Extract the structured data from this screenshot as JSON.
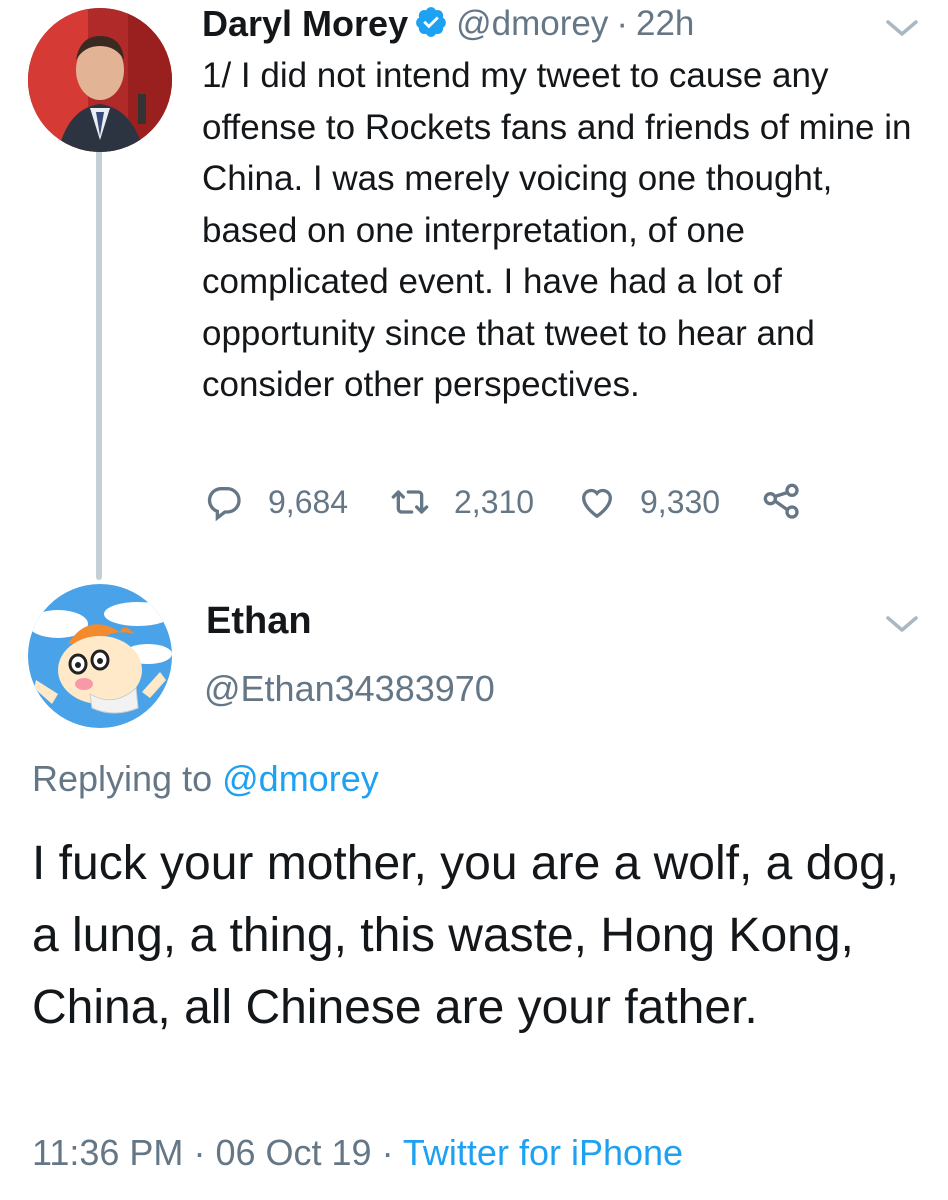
{
  "original_tweet": {
    "author_name": "Daryl Morey",
    "handle": "@dmorey",
    "time_sep": "·",
    "time": "22h",
    "verified": true,
    "text": "1/ I did not intend my tweet to cause any offense to Rockets fans and friends of mine in China. I was merely voicing one thought, based on one interpretation, of one complicated event. I have had a lot of opportunity since that tweet to hear and consider other perspectives.",
    "actions": {
      "replies": "9,684",
      "retweets": "2,310",
      "likes": "9,330"
    },
    "icons": [
      "reply-icon",
      "retweet-icon",
      "like-icon",
      "share-icon",
      "chevron-down-icon",
      "verified-badge-icon"
    ]
  },
  "reply_tweet": {
    "author_name": "Ethan",
    "handle": "@Ethan34383970",
    "replying_to_label": "Replying to",
    "replying_to_handle": "@dmorey",
    "text": "I fuck your mother, you are a wolf, a dog, a lung, a thing, this waste, Hong Kong, China, all Chinese are your father.",
    "timestamp": "11:36 PM",
    "date_sep": "·",
    "date": "06 Oct 19",
    "source_sep": "·",
    "source": "Twitter for iPhone"
  },
  "colors": {
    "text": "#14171a",
    "muted": "#657786",
    "accent": "#1da1f2",
    "thread_line": "#c4cfd6"
  }
}
